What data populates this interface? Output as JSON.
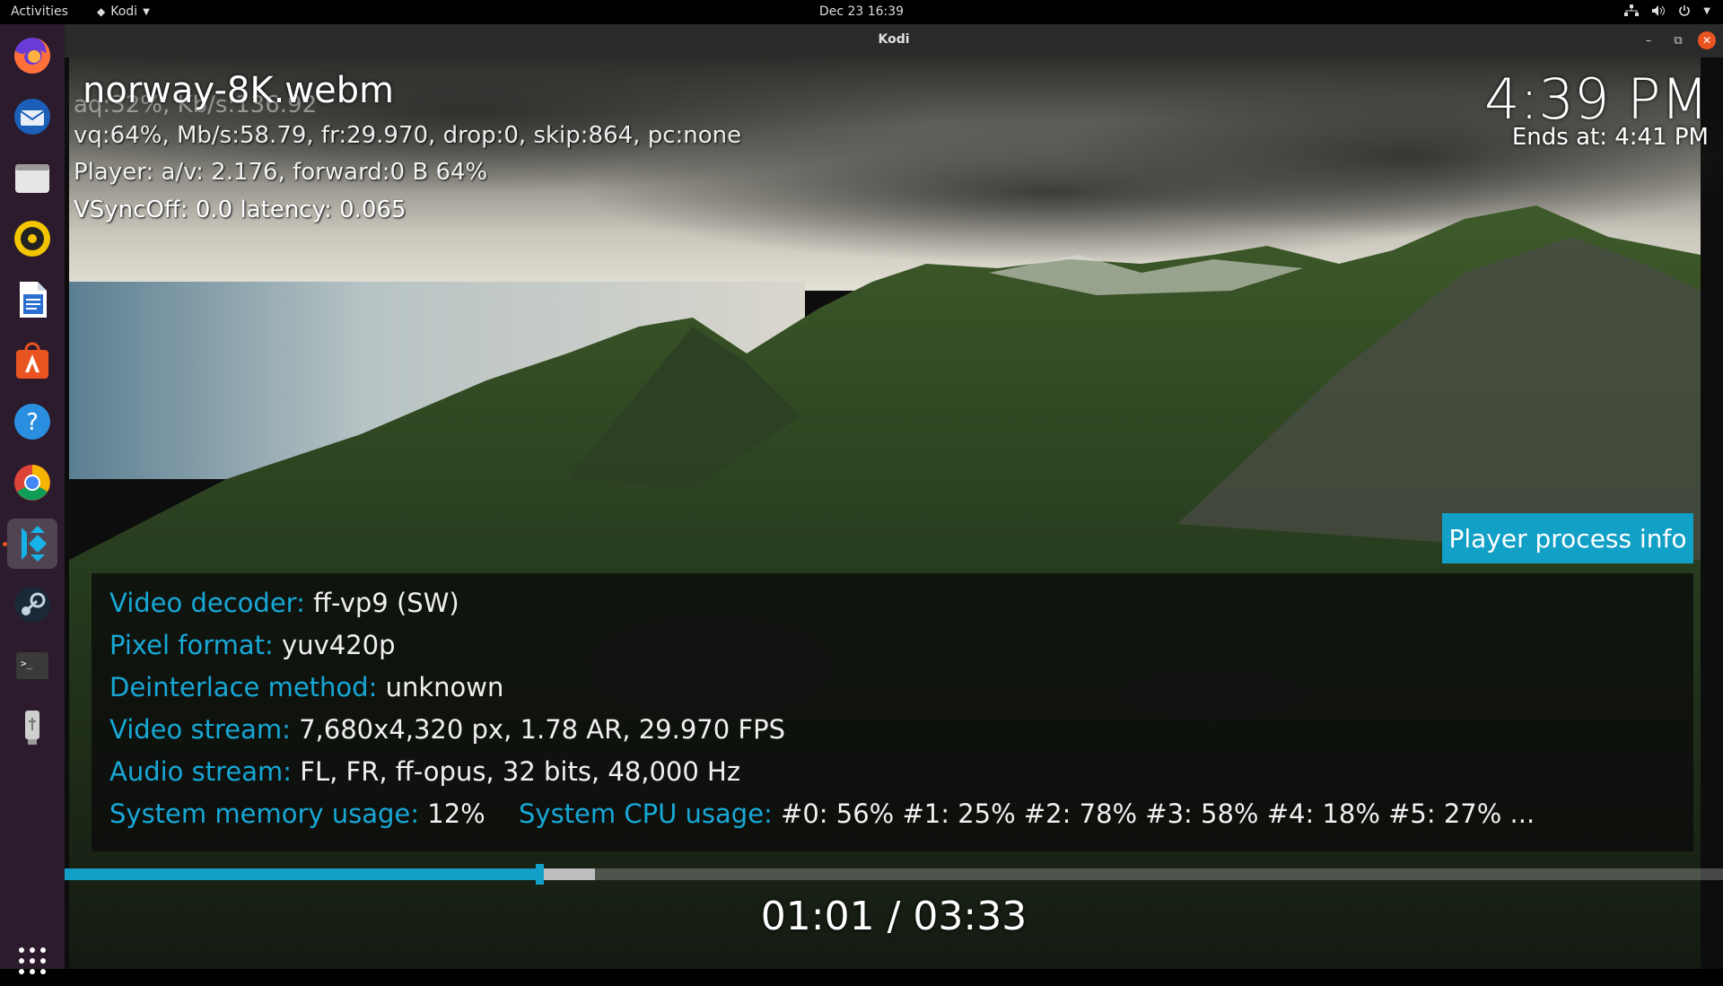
{
  "topbar": {
    "activities": "Activities",
    "app_menu": "Kodi",
    "clock": "Dec 23  16:39"
  },
  "window": {
    "title": "Kodi",
    "controls": [
      "minimize",
      "restore",
      "close"
    ]
  },
  "dock": {
    "items": [
      {
        "name": "firefox-icon",
        "color": "#ff7139"
      },
      {
        "name": "thunderbird-icon",
        "color": "#2a7fd4"
      },
      {
        "name": "files-icon",
        "color": "#cfcfcf"
      },
      {
        "name": "rhythmbox-icon",
        "color": "#f2c500"
      },
      {
        "name": "libreoffice-writer-icon",
        "color": "#2a6fd0"
      },
      {
        "name": "app-center-icon",
        "color": "#e95420"
      },
      {
        "name": "help-icon",
        "color": "#2a8fe0"
      },
      {
        "name": "chrome-icon",
        "color": "#34a853"
      },
      {
        "name": "kodi-icon",
        "color": "#17b2e7"
      },
      {
        "name": "steam-icon",
        "color": "#1b2838"
      },
      {
        "name": "terminal-icon",
        "color": "#333333"
      },
      {
        "name": "usb-drive-icon",
        "color": "#bbbbbb"
      }
    ],
    "show_apps": "show-apps-grid-icon"
  },
  "osd": {
    "filename": "norway-8K.webm",
    "debug_line1": "aq:32%, Kb/s:136.92",
    "debug_line2": "vq:64%, Mb/s:58.79, fr:29.970, drop:0, skip:864, pc:none",
    "debug_line3": "Player: a/v: 2.176,  forward:0 B 64%",
    "debug_line4": "VSyncOff: 0.0 latency: 0.065",
    "time_now": "4:39 PM",
    "ends_at": "Ends at: 4:41 PM",
    "process_button": "Player process info"
  },
  "info": {
    "video_decoder_label": "Video decoder:",
    "video_decoder_value": "ff-vp9 (SW)",
    "pixel_format_label": "Pixel format:",
    "pixel_format_value": "yuv420p",
    "deinterlace_label": "Deinterlace method:",
    "deinterlace_value": "unknown",
    "video_stream_label": "Video stream:",
    "video_stream_value": "7,680x4,320 px, 1.78 AR, 29.970 FPS",
    "audio_stream_label": "Audio stream:",
    "audio_stream_value": "FL, FR, ff-opus, 32 bits, 48,000 Hz",
    "memory_label": "System memory usage:",
    "memory_value": "12%",
    "cpu_label": "System CPU usage:",
    "cpu_value": "#0:  56% #1:  25% #2:  78% #3:  58% #4:  18% #5:  27% ..."
  },
  "playback": {
    "time_display": "01:01 / 03:33",
    "progress_fraction": 0.286,
    "buffer_fraction": 0.32
  },
  "colors": {
    "accent": "#12a0c7",
    "label": "#17a8d6"
  }
}
